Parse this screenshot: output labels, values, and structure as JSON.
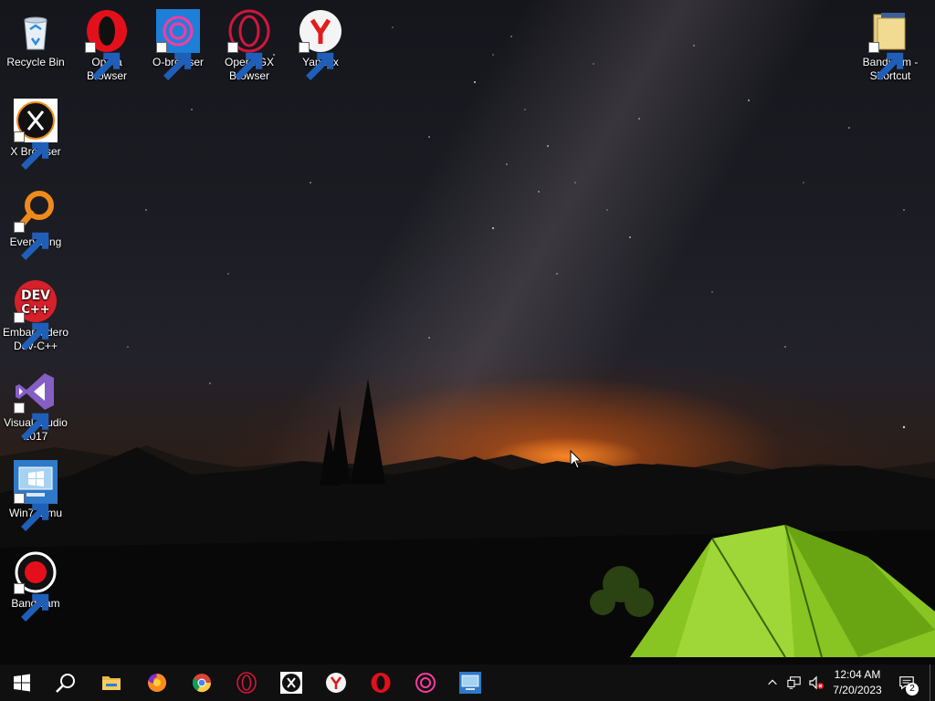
{
  "desktop": {
    "icons": [
      {
        "label": "Recycle Bin"
      },
      {
        "label": "Opera\nBrowser"
      },
      {
        "label": "O-browser"
      },
      {
        "label": "Opera GX\nBrowser"
      },
      {
        "label": "Yandex"
      },
      {
        "label": "Bandicam -\nShortcut"
      },
      {
        "label": "X Browser"
      },
      {
        "label": "Everything"
      },
      {
        "label": "Embarcadero\nDev-C++"
      },
      {
        "label": "Visual Studio\n2017"
      },
      {
        "label": "Win7 Simu"
      },
      {
        "label": "Bandicam"
      }
    ]
  },
  "taskbar": {
    "pinned": [
      "start-icon",
      "search-icon",
      "file-explorer-icon",
      "firefox-icon",
      "chrome-icon",
      "opera-gx-icon",
      "x-browser-icon",
      "yandex-icon",
      "opera-icon",
      "o-browser-icon",
      "win7-simu-icon"
    ],
    "clock_time": "12:04 AM",
    "clock_date": "7/20/2023",
    "notification_count": "2"
  },
  "colors": {
    "opera_red": "#e3101b",
    "obrowser_blue": "#1e7fd8",
    "gx_red": "#d0163c",
    "vs_purple": "#865fc5",
    "tent_green": "#9bd82a",
    "taskbar": "#101010"
  }
}
